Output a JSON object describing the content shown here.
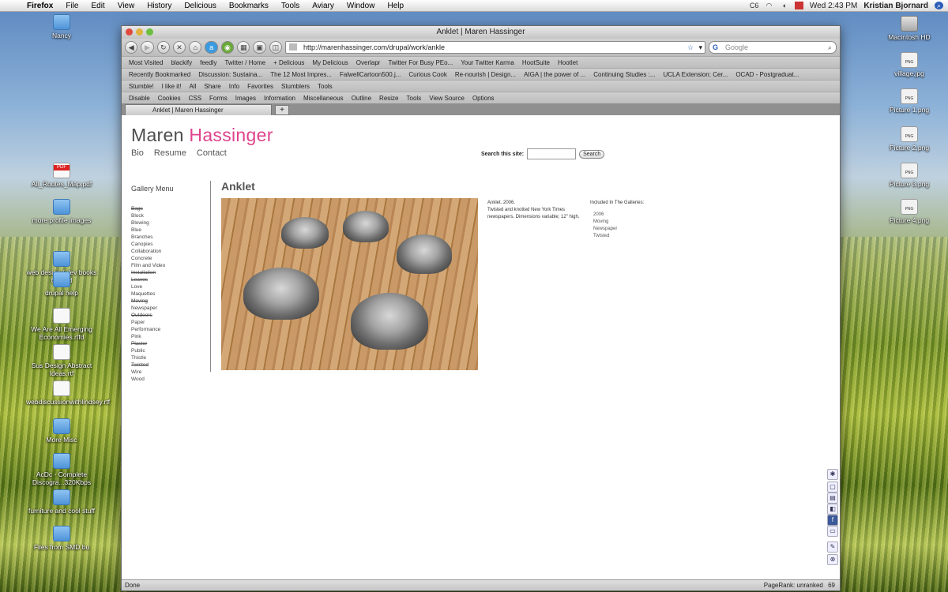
{
  "menubar": {
    "app": "Firefox",
    "items": [
      "File",
      "Edit",
      "View",
      "History",
      "Delicious",
      "Bookmarks",
      "Tools",
      "Aviary",
      "Window",
      "Help"
    ],
    "clock": "Wed 2:43 PM",
    "user": "Kristian Bjornard"
  },
  "desktop_icons": [
    {
      "label": "Nancy",
      "type": "folder"
    },
    {
      "label": "All_Routes_Map.pdf",
      "type": "pdf"
    },
    {
      "label": "more profile images",
      "type": "folder"
    },
    {
      "label": "web design / dev books to read",
      "type": "folder"
    },
    {
      "label": "drupal help",
      "type": "folder"
    },
    {
      "label": "We Are All Emerging Economies.rtfd",
      "type": "doc"
    },
    {
      "label": "Sus Design Abstract Ideas.rtf",
      "type": "doc"
    },
    {
      "label": "webdiscussionwithlindsey.rtf",
      "type": "doc"
    },
    {
      "label": "More Misc",
      "type": "folder"
    },
    {
      "label": "AcDc - Complete Discogra...320Kbps",
      "type": "folder"
    },
    {
      "label": "furniture and cool stuff",
      "type": "folder"
    },
    {
      "label": "Files from SMD bu",
      "type": "folder"
    },
    {
      "label": "Macintosh HD",
      "type": "hd"
    },
    {
      "label": "village.jpg",
      "type": "png"
    },
    {
      "label": "Picture 1.png",
      "type": "png"
    },
    {
      "label": "Picture 2.png",
      "type": "png"
    },
    {
      "label": "Picture 3.png",
      "type": "png"
    },
    {
      "label": "Picture 4.png",
      "type": "png"
    }
  ],
  "browser": {
    "window_title": "Anklet | Maren Hassinger",
    "url": "http://marenhassinger.com/drupal/work/ankle",
    "search_placeholder": "Google",
    "bookmarks": [
      "Most Visited",
      "blackify",
      "feedly",
      "Twitter / Home",
      "+ Delicious",
      "My Delicious",
      "Overlapr",
      "Twitter For Busy PEo...",
      "Your Twitter Karma",
      "HootSuite",
      "Hootlet"
    ],
    "bookmarks2": [
      "Recently Bookmarked",
      "Discussion: Sustaina...",
      "The 12 Most Impres...",
      "FalwellCartoon500.j...",
      "Curious Cook",
      "Re-nourish | Design...",
      "AIGA | the power of ...",
      "Continuing Studies :...",
      "UCLA Extension: Cer...",
      "OCAD - Postgraduat..."
    ],
    "stumble_bar": [
      "Stumble!",
      "I like it!",
      "All",
      "Share",
      "Info",
      "Favorites",
      "Stumblers",
      "Tools"
    ],
    "dev_bar": [
      "Disable",
      "Cookies",
      "CSS",
      "Forms",
      "Images",
      "Information",
      "Miscellaneous",
      "Outline",
      "Resize",
      "Tools",
      "View Source",
      "Options"
    ],
    "tab_label": "Anklet | Maren Hassinger",
    "status_left": "Done",
    "status_right": "PageRank: unranked",
    "status_count": "69"
  },
  "page": {
    "site_first": "Maren",
    "site_last": "Hassinger",
    "nav": [
      "Bio",
      "Resume",
      "Contact"
    ],
    "search_label": "Search this site:",
    "search_button": "Search",
    "gallery_menu_title": "Gallery Menu",
    "gallery_items": [
      {
        "label": "Bags",
        "strike": true
      },
      {
        "label": "Block",
        "strike": false
      },
      {
        "label": "Blowing",
        "strike": false
      },
      {
        "label": "Blue",
        "strike": false
      },
      {
        "label": "Branches",
        "strike": false
      },
      {
        "label": "Canopies",
        "strike": false
      },
      {
        "label": "Collaboration",
        "strike": false
      },
      {
        "label": "Concrete",
        "strike": false
      },
      {
        "label": "Film and Video",
        "strike": false
      },
      {
        "label": "Installation",
        "strike": true
      },
      {
        "label": "Leaves",
        "strike": true
      },
      {
        "label": "Love",
        "strike": false
      },
      {
        "label": "Maquettes",
        "strike": false
      },
      {
        "label": "Moving",
        "strike": true
      },
      {
        "label": "Newspaper",
        "strike": false
      },
      {
        "label": "Outdoors",
        "strike": true
      },
      {
        "label": "Paper",
        "strike": false
      },
      {
        "label": "Performance",
        "strike": false
      },
      {
        "label": "Pink",
        "strike": false
      },
      {
        "label": "Plaster",
        "strike": true
      },
      {
        "label": "Public",
        "strike": false
      },
      {
        "label": "Thistle",
        "strike": false
      },
      {
        "label": "Twisted",
        "strike": true
      },
      {
        "label": "Wire",
        "strike": false
      },
      {
        "label": "Wood",
        "strike": false
      }
    ],
    "title": "Anklet",
    "caption_line1": "Anklet. 2006.",
    "caption_line2": "Twisted and knotted New York Times newspapers. Dimensions variable; 12\" high.",
    "galleries_title": "Included In The Galleries:",
    "galleries": [
      "2006",
      "Moving",
      "Newspaper",
      "Twisted"
    ]
  },
  "colors": {
    "accent_pink": "#e0428c",
    "name_grey": "#4d4d4d"
  }
}
